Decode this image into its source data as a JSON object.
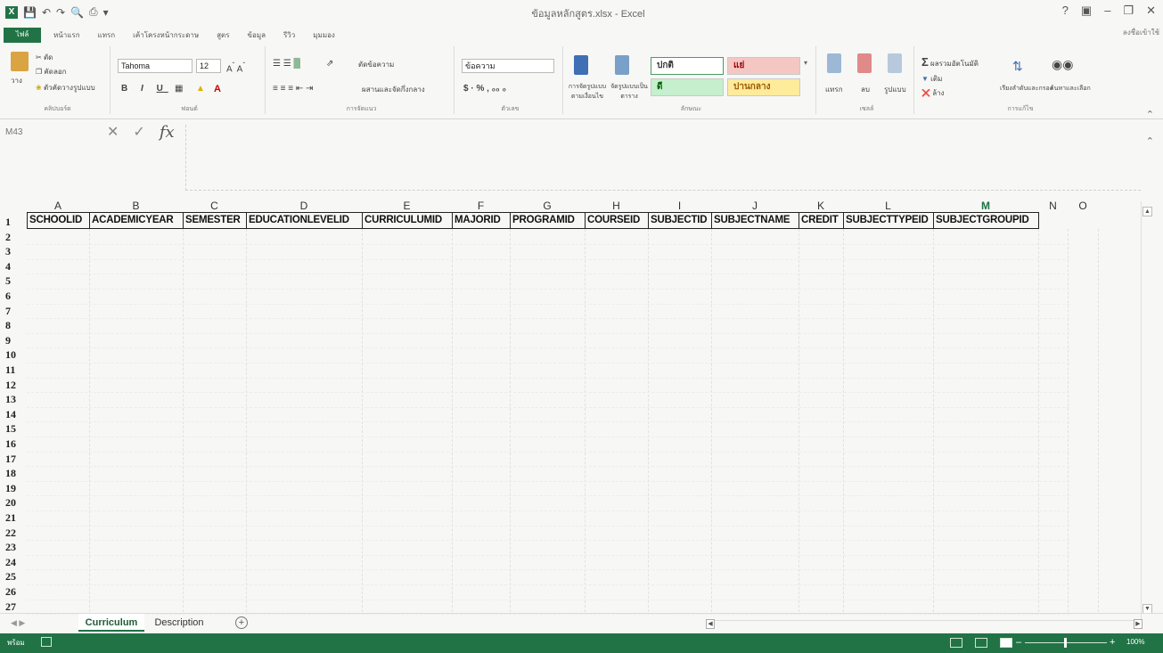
{
  "window": {
    "title": "ข้อมูลหลักสูตร.xlsx - Excel",
    "signin": "ลงชื่อเข้าใช้"
  },
  "tabs": [
    "ไฟล์",
    "หน้าแรก",
    "แทรก",
    "เค้าโครงหน้ากระดาษ",
    "สูตร",
    "ข้อมูล",
    "รีวิว",
    "มุมมอง"
  ],
  "ribbon": {
    "paste": "วาง",
    "cut": "ตัด",
    "copy": "คัดลอก",
    "format_painter": "ตัวคัดวางรูปแบบ",
    "clipboard": "คลิปบอร์ด",
    "font_name": "Tahoma",
    "font_size": "12",
    "font_group": "ฟอนต์",
    "wrap_text": "ตัดข้อความ",
    "merge_center": "ผสานและจัดกึ่งกลาง",
    "alignment_group": "การจัดแนว",
    "number_format": "ข้อความ",
    "number_group": "ตัวเลข",
    "conditional_format": "การจัดรูปแบบตามเงื่อนไข",
    "format_as_table": "จัดรูปแบบเป็นตาราง",
    "style_normal": "ปกติ",
    "style_bad": "แย่",
    "style_good": "ดี",
    "style_neutral": "ปานกลาง",
    "styles_group": "ลักษณะ",
    "insert": "แทรก",
    "delete": "ลบ",
    "format": "รูปแบบ",
    "cells_group": "เซลล์",
    "autosum": "ผลรวมอัตโนมัติ",
    "fill": "เติม",
    "clear": "ล้าง",
    "sort_filter": "เรียงลำดับและกรอง",
    "find_select": "ค้นหาและเลือก",
    "editing_group": "การแก้ไข"
  },
  "formula_bar": {
    "name_box": "M43",
    "formula": ""
  },
  "columns": [
    "A",
    "B",
    "C",
    "D",
    "E",
    "F",
    "G",
    "H",
    "I",
    "J",
    "K",
    "L",
    "M",
    "N",
    "O"
  ],
  "active_column": "M",
  "rows": [
    "1",
    "2",
    "3",
    "4",
    "5",
    "6",
    "7",
    "8",
    "9",
    "10",
    "11",
    "12",
    "13",
    "14",
    "15",
    "16",
    "17",
    "18",
    "19",
    "20",
    "21",
    "22",
    "23",
    "24",
    "25",
    "26",
    "27"
  ],
  "headers": [
    "SCHOOLID",
    "ACADEMICYEAR",
    "SEMESTER",
    "EDUCATIONLEVELID",
    "CURRICULUMID",
    "MAJORID",
    "PROGRAMID",
    "COURSEID",
    "SUBJECTID",
    "SUBJECTNAME",
    "CREDIT",
    "SUBJECTTYPEID",
    "SUBJECTGROUPID"
  ],
  "sheets": [
    {
      "name": "Curriculum",
      "active": true
    },
    {
      "name": "Description",
      "active": false
    }
  ],
  "status": {
    "ready": "พร้อม",
    "zoom": "100%"
  },
  "colors": {
    "excel_green": "#217346",
    "active_header": "#1e7145"
  }
}
